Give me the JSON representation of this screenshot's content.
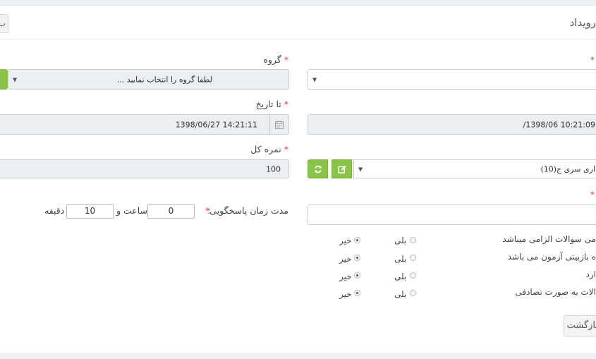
{
  "header": {
    "title": "رویداد",
    "top_button_label": "ب"
  },
  "form": {
    "group": {
      "label": "گروه",
      "required_mark": "*",
      "placeholder": "لطفا گروه را انتخاب نمایید ..."
    },
    "right_select_required_mark": "*",
    "to_date": {
      "label": "تا تاریخ",
      "required_mark": "*",
      "value": "14:21:11 1398/06/27"
    },
    "from_date": {
      "value": "10:21:09 1398/06/"
    },
    "total_score": {
      "label": "نمره کل",
      "required_mark": "*",
      "value": "100"
    },
    "series_select": {
      "value": "اری سری ج(10)"
    },
    "right_text_required_mark": "*",
    "response_time": {
      "label": "مدت زمان پاسخگویی",
      "required_mark": "*",
      "colon": ":",
      "hours_value": "0",
      "hours_unit": "ساعت و",
      "minutes_value": "10",
      "minutes_unit": "دقیقه"
    },
    "options": [
      {
        "label": "می سوالات الزامی میباشد",
        "yes": "بلی",
        "no": "خیر",
        "selected": "no"
      },
      {
        "label": "ه بازبینی آزمون می باشد",
        "yes": "بلی",
        "no": "خیر",
        "selected": "no"
      },
      {
        "label": "ارد",
        "yes": "بلی",
        "no": "خیر",
        "selected": "no"
      },
      {
        "label": "الات به صورت تصادفی",
        "yes": "بلی",
        "no": "خیر",
        "selected": "no"
      }
    ]
  },
  "footer": {
    "back_button_label": "بازگشت"
  },
  "icons": {
    "calendar": "calendar-icon",
    "refresh": "refresh-icon",
    "edit": "edit-icon",
    "caret": "caret-down-icon"
  },
  "colors": {
    "accent_green": "#8bc34a",
    "required_red": "#e0393e",
    "readonly_bg": "#eceff2"
  }
}
